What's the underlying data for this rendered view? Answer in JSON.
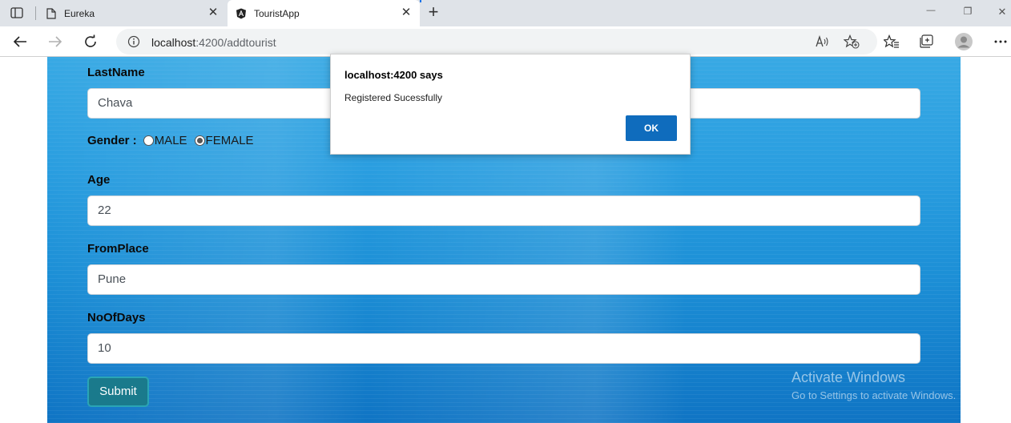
{
  "browser": {
    "tabs": [
      {
        "title": "Eureka",
        "close": "✕"
      },
      {
        "title": "TouristApp",
        "close": "✕"
      }
    ],
    "new_tab": "+",
    "url_host": "localhost",
    "url_path": ":4200/addtourist",
    "window_controls": {
      "minimize": "—",
      "restore": "❐",
      "close": "✕"
    }
  },
  "form": {
    "lastname_label": "LastName",
    "lastname_value": "Chava",
    "gender_label": "Gender :",
    "gender_options": [
      "MALE",
      "FEMALE"
    ],
    "gender_selected": "FEMALE",
    "age_label": "Age",
    "age_value": "22",
    "fromplace_label": "FromPlace",
    "fromplace_value": "Pune",
    "noofdays_label": "NoOfDays",
    "noofdays_value": "10",
    "submit_label": "Submit"
  },
  "watermark": {
    "line1": "Activate Windows",
    "line2": "Go to Settings to activate Windows."
  },
  "alert": {
    "title": "localhost:4200 says",
    "message": "Registered Sucessfully",
    "ok_label": "OK"
  },
  "colors": {
    "accent": "#0f6cbd",
    "submit_bg": "#1a7a8c",
    "background_water": "#2a9ee0"
  }
}
